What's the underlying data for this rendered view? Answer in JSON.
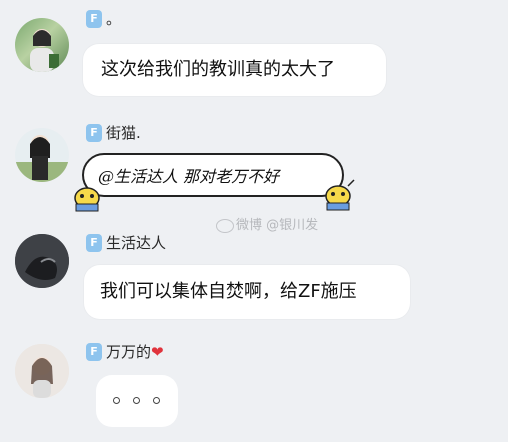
{
  "messages": [
    {
      "badge": "F",
      "name": "。",
      "text": "这次给我们的教训真的太大了"
    },
    {
      "badge": "F",
      "name": "街猫.",
      "text": "@生活达人 那对老万不好"
    },
    {
      "badge": "F",
      "name": "生活达人",
      "text": "我们可以集体自焚啊，给ZF施压"
    },
    {
      "badge": "F",
      "name": "万万的",
      "text": "。。。",
      "name_suffix": "❤"
    }
  ],
  "watermark": "微博 @银川发",
  "colors": {
    "background": "#eef0f3",
    "bubble": "#ffffff",
    "badge": "#8ec4ee",
    "heart": "#e0333c"
  },
  "icons": [
    "avatar",
    "weibo-icon",
    "heart-icon",
    "cartoon-sticker-icon"
  ]
}
